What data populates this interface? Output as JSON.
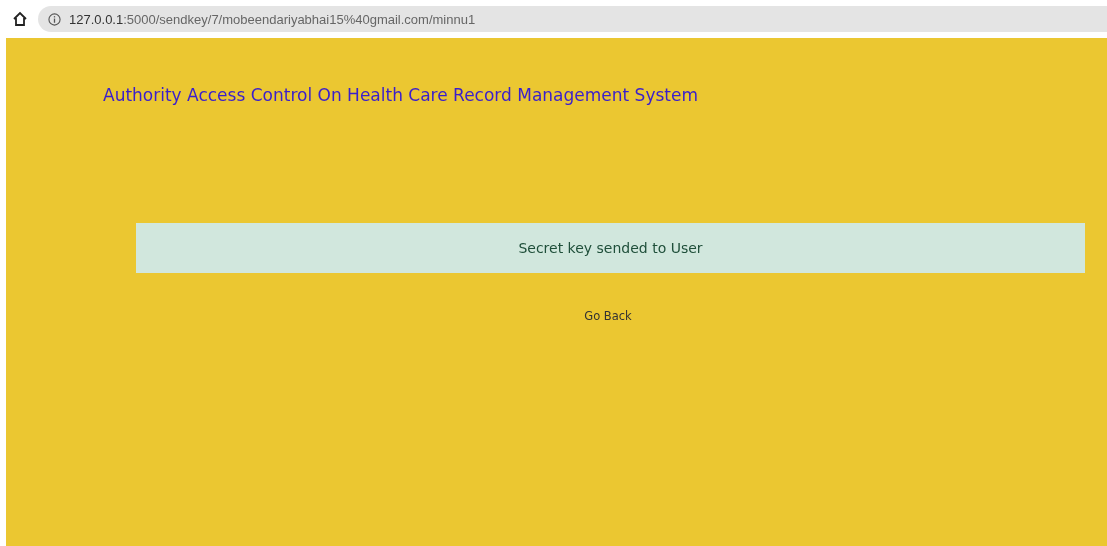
{
  "browser": {
    "url_host": "127.0.0.1",
    "url_rest": ":5000/sendkey/7/mobeendariyabhai15%40gmail.com/minnu1"
  },
  "page": {
    "title": "Authority Access Control On Health Care Record Management System",
    "alert": "Secret key sended to User",
    "back_link": "Go Back"
  }
}
